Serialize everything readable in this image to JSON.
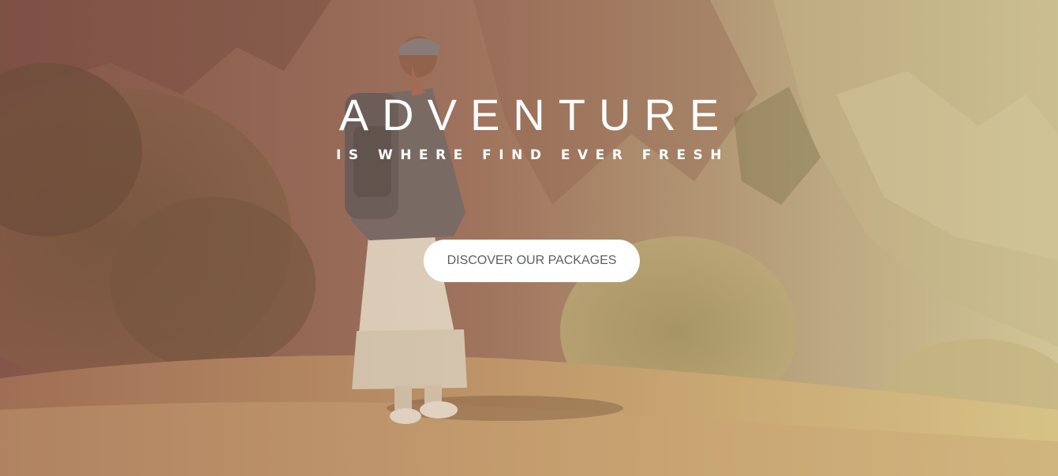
{
  "hero": {
    "title": "ADVENTURE",
    "subtitle": "IS WHERE FIND EVER FRESH",
    "cta_label": "DISCOVER OUR PACKAGES"
  },
  "colors": {
    "text": "#ffffff",
    "button_bg": "#ffffff",
    "button_text": "#5a5f66"
  }
}
